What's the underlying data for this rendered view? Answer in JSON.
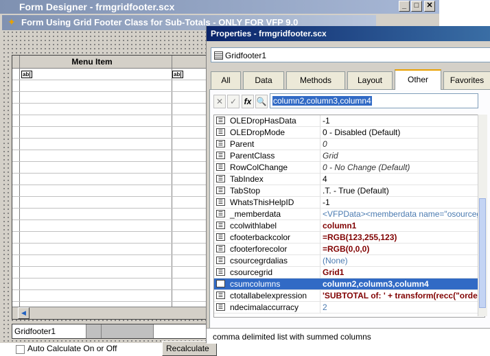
{
  "form_designer": {
    "title": "Form Designer - frmgridfooter.scx",
    "minimize": "_",
    "maximize": "□",
    "close": "✕"
  },
  "form": {
    "title": "Form Using Grid Footer Class for Sub-Totals - ONLY FOR VFP 9.0",
    "grid_column_header": "Menu Item",
    "textbox_icon": "ab|",
    "footer_name": "Gridfooter1",
    "auto_calc_label": "Auto Calculate On or Off",
    "recalc_button": "Recalculate"
  },
  "properties": {
    "title": "Properties - frmgridfooter.scx",
    "object": "Gridfooter1",
    "tabs": [
      {
        "label": "All"
      },
      {
        "label": "Data"
      },
      {
        "label": "Methods"
      },
      {
        "label": "Layout"
      },
      {
        "label": "Other"
      },
      {
        "label": "Favorites"
      }
    ],
    "active_tab": "Other",
    "value_input": "column2,column3,column4",
    "rows": [
      {
        "name": "OLEDropHasData",
        "value": "-1"
      },
      {
        "name": "OLEDropMode",
        "value": "0 - Disabled (Default)"
      },
      {
        "name": "Parent",
        "value": "0"
      },
      {
        "name": "ParentClass",
        "value": "Grid"
      },
      {
        "name": "RowColChange",
        "value": "0 - No Change (Default)"
      },
      {
        "name": "TabIndex",
        "value": "4"
      },
      {
        "name": "TabStop",
        "value": ".T. - True (Default)"
      },
      {
        "name": "WhatsThisHelpID",
        "value": "-1"
      },
      {
        "name": "_memberdata",
        "value": "<VFPData><memberdata name=\"osourcegr"
      },
      {
        "name": "ccolwithlabel",
        "value": "column1"
      },
      {
        "name": "cfooterbackcolor",
        "value": "=RGB(123,255,123)"
      },
      {
        "name": "cfooterforecolor",
        "value": "=RGB(0,0,0)"
      },
      {
        "name": "csourcegrdalias",
        "value": "(None)"
      },
      {
        "name": "csourcegrid",
        "value": "Grid1"
      },
      {
        "name": "csumcolumns",
        "value": "column2,column3,column4"
      },
      {
        "name": "ctotallabelexpression",
        "value": "'SUBTOTAL of: ' + transform(recc(\"order_"
      },
      {
        "name": "ndecimalaccurracy",
        "value": "2"
      }
    ],
    "description": "comma delimited list with summed columns"
  }
}
